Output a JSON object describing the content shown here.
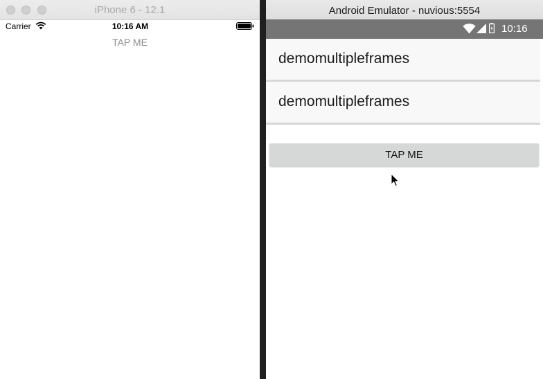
{
  "ios_simulator": {
    "title": "iPhone 6 - 12.1",
    "status_bar": {
      "carrier": "Carrier",
      "time": "10:16 AM",
      "wifi_icon": "wifi-icon",
      "battery_icon": "battery-icon"
    },
    "tap_button_label": "TAP ME"
  },
  "android_emulator": {
    "title": "Android Emulator - nuvious:5554",
    "status_bar": {
      "time": "10:16",
      "icons": [
        "wifi-icon",
        "signal-icon",
        "battery-icon"
      ],
      "background_color": "#757575"
    },
    "frames": [
      {
        "label": "demomultipleframes"
      },
      {
        "label": "demomultipleframes"
      }
    ],
    "tap_button_label": "TAP ME"
  },
  "colors": {
    "android_button_bg": "#d6d7d7",
    "ios_tap_text": "#8d8d8d",
    "card_bg": "#f8f8f8"
  }
}
